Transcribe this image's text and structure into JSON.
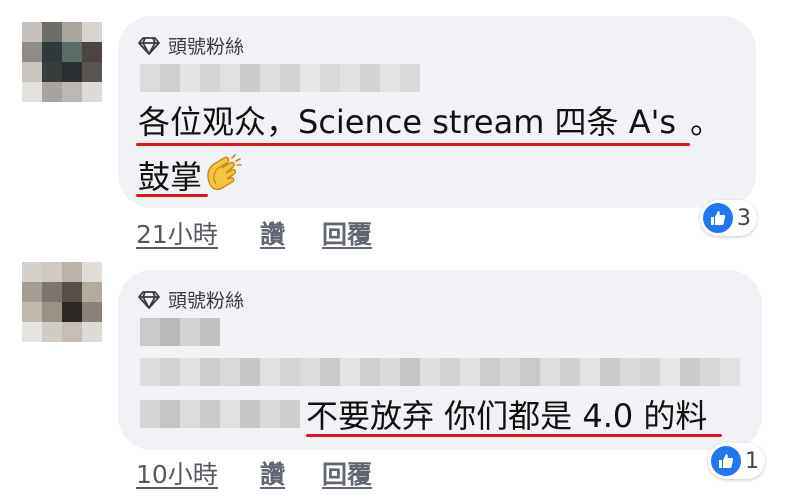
{
  "comments": [
    {
      "badge": "頭號粉絲",
      "text_main": "各位观众，Science stream 四条 A's",
      "text_end": "。",
      "text_line2": "鼓掌",
      "emoji_icon": "clapping-hands-icon",
      "time": "21小時",
      "like_label": "讚",
      "reply_label": "回覆",
      "reaction_icon": "thumbs-up-icon",
      "reaction_count": "3"
    },
    {
      "badge": "頭號粉絲",
      "text_main": "不要放弃 你们都是 4.0 的料",
      "time": "10小時",
      "like_label": "讚",
      "reply_label": "回覆",
      "reaction_icon": "thumbs-up-icon",
      "reaction_count": "1"
    }
  ],
  "colors": {
    "bubble": "#f0f2f5",
    "underline": "#e4141c",
    "like_blue": "#1f77f2"
  }
}
